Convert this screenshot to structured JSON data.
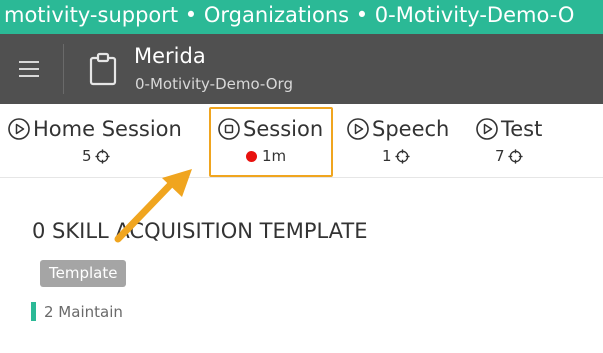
{
  "breadcrumb": "motivity-support • Organizations • 0-Motivity-Demo-O",
  "header": {
    "title": "Merida",
    "subtitle": "0-Motivity-Demo-Org"
  },
  "tabs": [
    {
      "label": "Home Session",
      "count": "5",
      "icon": "play-circle-icon"
    },
    {
      "label": "Session",
      "timer": "1m",
      "icon": "stop-circle-icon",
      "status_color": "#e8110e"
    },
    {
      "label": "Speech",
      "count": "1",
      "icon": "play-circle-icon"
    },
    {
      "label": "Test",
      "count": "7",
      "icon": "play-circle-icon"
    }
  ],
  "content": {
    "title": "0 SKILL ACQUISITION TEMPLATE",
    "badge": "Template",
    "maintain_label": "2 Maintain"
  },
  "colors": {
    "accent": "#2bb996",
    "header_bg": "#505050",
    "highlight": "#f0a51f",
    "recording_dot": "#e8110e"
  }
}
